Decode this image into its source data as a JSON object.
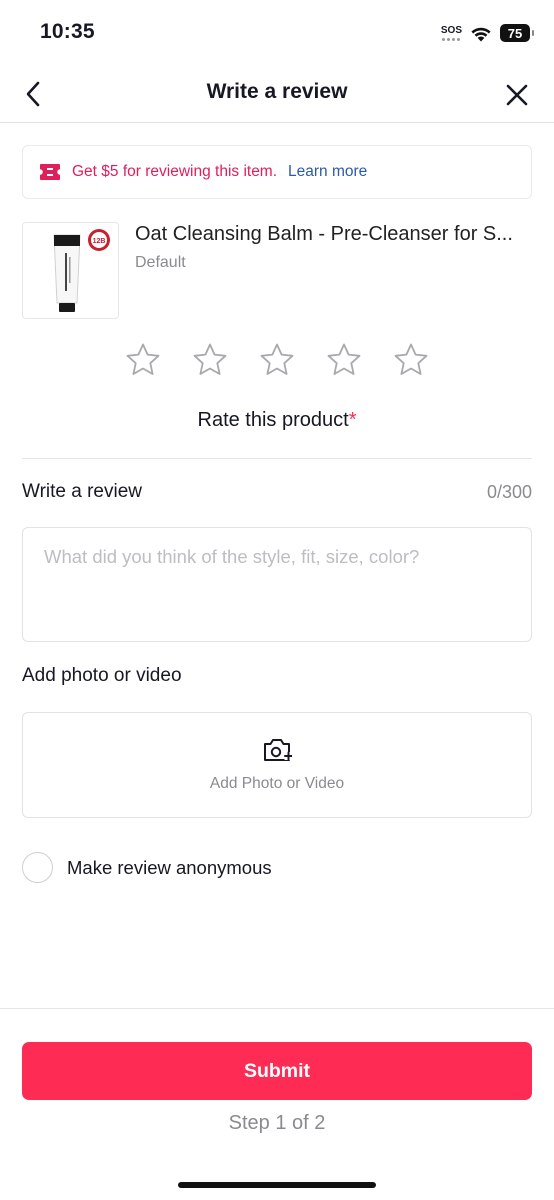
{
  "status_bar": {
    "time": "10:35",
    "sos": "SOS",
    "battery": "75"
  },
  "nav": {
    "title": "Write a review",
    "back_icon": "chevron-left-icon",
    "close_icon": "close-icon"
  },
  "promo": {
    "icon": "ticket-icon",
    "text": "Get $5 for reviewing this item.",
    "link": "Learn more",
    "accent": "#e01e5a",
    "link_color": "#2b5aa8"
  },
  "product": {
    "title": "Oat Cleansing Balm - Pre-Cleanser for S...",
    "variant": "Default",
    "thumb_badge": "12B"
  },
  "rating": {
    "label": "Rate this product",
    "required_mark": "*",
    "star_count": 5,
    "selected": 0
  },
  "review": {
    "label": "Write a review",
    "count": "0/300",
    "placeholder": "What did you think of the style, fit, size, color?",
    "value": ""
  },
  "media": {
    "label": "Add photo or video",
    "button_text": "Add Photo or Video",
    "icon": "camera-plus-icon"
  },
  "anonymous": {
    "label": "Make review anonymous",
    "checked": false
  },
  "footer": {
    "submit_label": "Submit",
    "step_text": "Step 1 of 2",
    "primary_color": "#fe2c55"
  }
}
